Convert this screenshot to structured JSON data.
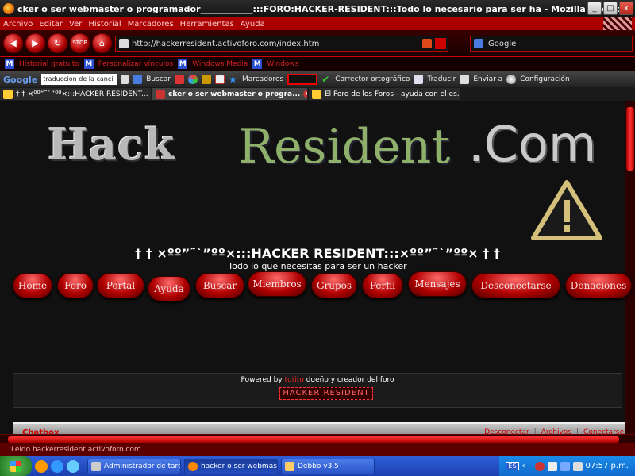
{
  "window": {
    "title": "cker o ser webmaster o programador____________:::FORO:HACKER-RESIDENT:::Todo lo necesario para ser ha - Mozilla Firefox",
    "buttons": {
      "minimize": "_",
      "maximize": "□",
      "close": "x"
    }
  },
  "menu": [
    "Archivo",
    "Editar",
    "Ver",
    "Historial",
    "Marcadores",
    "Herramientas",
    "Ayuda"
  ],
  "nav": {
    "url": "http://hackerresident.activoforo.com/index.htm",
    "search_engine": "Google",
    "stop_label": "STOP"
  },
  "bookmarks": [
    "Historial gratuito",
    "Personalizar vínculos",
    "Windows Media",
    "Windows"
  ],
  "google_toolbar": {
    "logo": "Google",
    "query": "traduccion de la canci",
    "search_label": "Buscar",
    "bookmarks_label": "Marcadores",
    "spell_label": "Corrector ortográfico",
    "translate_label": "Traducir",
    "send_label": "Enviar a",
    "settings_label": "Configuración"
  },
  "tabs": [
    {
      "label": "† † ×ºº”˜`”ºº×:::HACKER RESIDENT...",
      "active": false
    },
    {
      "label": "cker o ser webmaster o progra...",
      "active": true
    },
    {
      "label": "El Foro de los Foros - ayuda con el es...",
      "active": false
    }
  ],
  "page": {
    "logo_hack": "Hack",
    "logo_resident": "Resident",
    "logo_com": ".Com",
    "site_title": "† † ×ºº”˜`”ºº×:::HACKER RESIDENT:::×ºº”˜`”ºº× † †",
    "site_subtitle": "Todo lo que necesitas para ser un hacker",
    "nav_items": [
      "Home",
      "Foro",
      "Portal",
      "Ayuda",
      "Buscar",
      "Miembros",
      "Grupos",
      "Perfil",
      "Mensajes",
      "Desconectarse",
      "Donaciones"
    ],
    "powered_prefix": "Powered by",
    "powered_link": "tutito",
    "powered_suffix": "dueño y creador del foro",
    "badge": "HACKER RESIDENT",
    "chatbox_title": "Chatbox",
    "chat_links": [
      "Desconectar",
      "Archivos",
      "Conectarse"
    ]
  },
  "status_text": "Leído hackerresident.activoforo.com",
  "taskbar": {
    "tasks": [
      "Administrador de tare...",
      "hacker o ser webmast...",
      "Debbo v3.5"
    ],
    "lang": "ES",
    "time": "07:57 p.m."
  }
}
